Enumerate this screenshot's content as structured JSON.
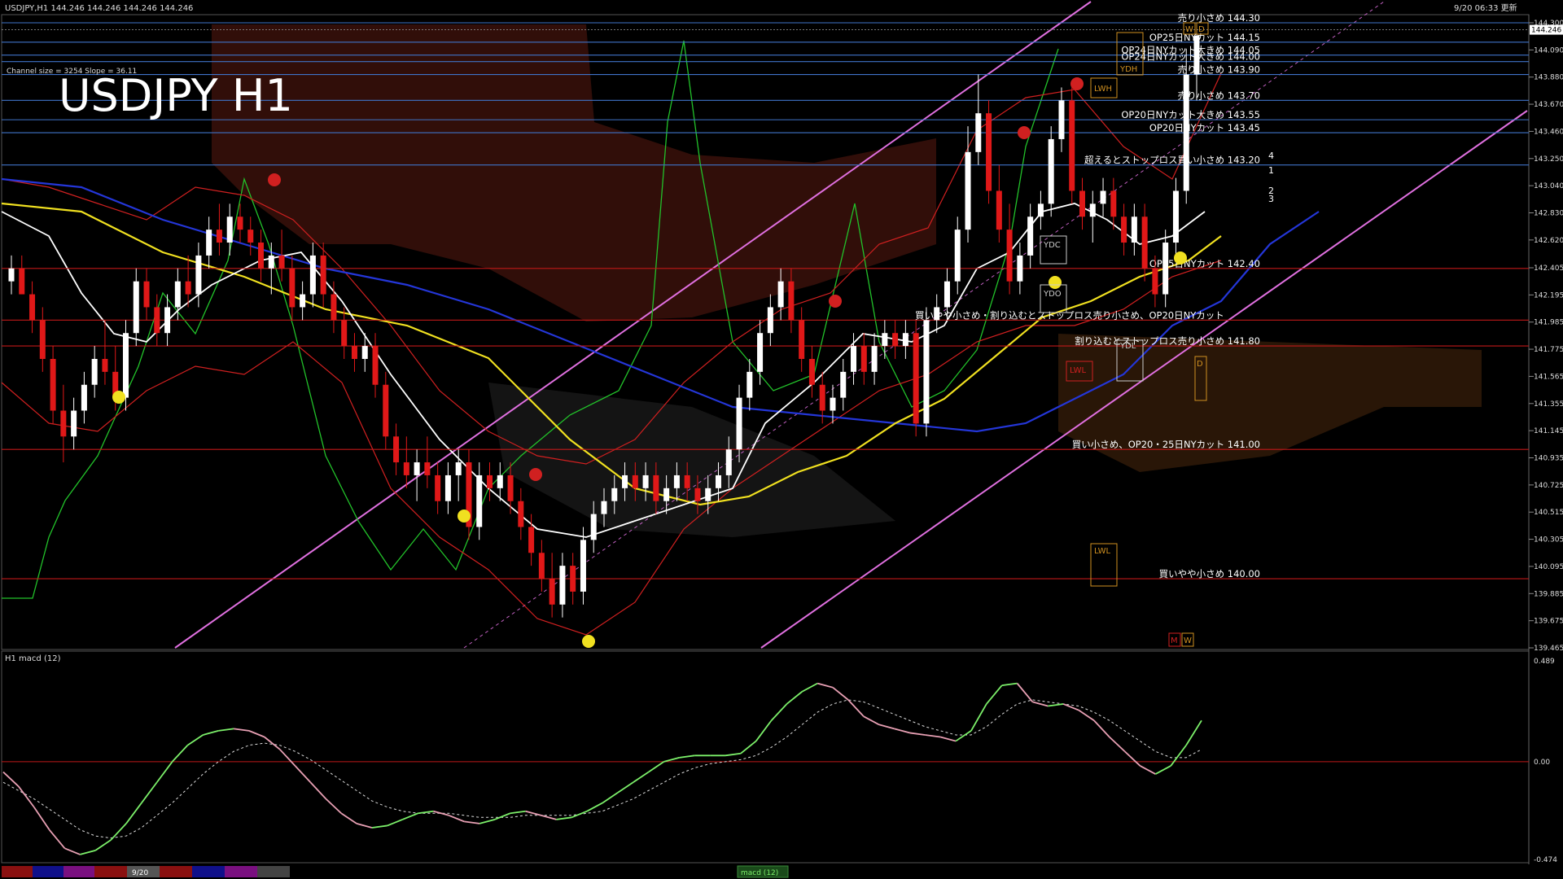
{
  "header": {
    "symbol_info": "USDJPY,H1  144.246 144.246 144.246 144.246",
    "datetime": "9/20 06:33 更新",
    "title": "USDJPY H1",
    "channel_info": "Channel size = 3254 Slope = 36.11"
  },
  "subwindow": {
    "label": "H1  macd (12)"
  },
  "bottom_tabs": {
    "active_date": "9/20",
    "macd_tab": "macd (12)"
  },
  "colors": {
    "background": "#000000",
    "price_line": "#4a7fcf",
    "macd_up": "#7cf06a",
    "macd_down": "#e8a0b4"
  },
  "chart_data": [
    {
      "type": "candlestick",
      "title": "USDJPY H1",
      "ylim": [
        139.465,
        144.3
      ],
      "current_price": 144.246,
      "y_ticks": [
        144.3,
        144.09,
        143.88,
        143.67,
        143.46,
        143.25,
        143.04,
        142.83,
        142.62,
        142.405,
        142.195,
        141.985,
        141.775,
        141.565,
        141.355,
        141.145,
        140.935,
        140.725,
        140.515,
        140.305,
        140.095,
        139.885,
        139.675,
        139.465
      ],
      "levels": [
        {
          "price": 144.3,
          "label": "売り小さめ 144.30"
        },
        {
          "price": 144.15,
          "label": "OP25日NYカット 144.15"
        },
        {
          "price": 144.05,
          "label": "OP24日NYカット大きめ 144.05"
        },
        {
          "price": 144.0,
          "label": "OP24日NYカット大きめ 144.00"
        },
        {
          "price": 143.9,
          "label": "売り小さめ 143.90"
        },
        {
          "price": 143.7,
          "label": "売り小さめ 143.70"
        },
        {
          "price": 143.55,
          "label": "OP20日NYカット大きめ 143.55"
        },
        {
          "price": 143.45,
          "label": "OP20日NYカット 143.45"
        },
        {
          "price": 143.2,
          "label": "超えるとストップロス買い小さめ 143.20"
        },
        {
          "price": 142.4,
          "label": "OP25日NYカット 142.40"
        },
        {
          "price": 142.0,
          "label": "買いやや小さめ・割り込むとストップロス売り小さめ、OP20日NYカット"
        },
        {
          "price": 141.8,
          "label": "割り込むとストップロス売り小さめ 141.80"
        },
        {
          "price": 141.0,
          "label": "買い小さめ、OP20・25日NYカット 141.00"
        },
        {
          "price": 140.0,
          "label": "買いやや小さめ 140.00"
        }
      ],
      "line_numbers": [
        "4",
        "1",
        "2",
        "3"
      ],
      "box_labels": [
        "YDC",
        "YDO",
        "YDH",
        "YDL",
        "LWH",
        "LWL",
        "W",
        "D",
        "M"
      ],
      "candles": [
        [
          142.3,
          142.5,
          142.2,
          142.4
        ],
        [
          142.4,
          142.5,
          142.3,
          142.2
        ],
        [
          142.2,
          142.3,
          141.9,
          142.0
        ],
        [
          142.0,
          142.1,
          141.6,
          141.7
        ],
        [
          141.7,
          141.8,
          141.2,
          141.3
        ],
        [
          141.3,
          141.5,
          140.9,
          141.1
        ],
        [
          141.1,
          141.4,
          141.0,
          141.3
        ],
        [
          141.3,
          141.6,
          141.2,
          141.5
        ],
        [
          141.5,
          141.8,
          141.4,
          141.7
        ],
        [
          141.7,
          142.0,
          141.5,
          141.6
        ],
        [
          141.6,
          141.8,
          141.3,
          141.4
        ],
        [
          141.4,
          142.0,
          141.3,
          141.9
        ],
        [
          141.9,
          142.4,
          141.8,
          142.3
        ],
        [
          142.3,
          142.4,
          142.0,
          142.1
        ],
        [
          142.1,
          142.2,
          141.8,
          141.9
        ],
        [
          141.9,
          142.2,
          141.8,
          142.1
        ],
        [
          142.1,
          142.4,
          142.0,
          142.3
        ],
        [
          142.3,
          142.5,
          142.1,
          142.2
        ],
        [
          142.2,
          142.6,
          142.1,
          142.5
        ],
        [
          142.5,
          142.8,
          142.4,
          142.7
        ],
        [
          142.7,
          142.9,
          142.5,
          142.6
        ],
        [
          142.6,
          142.9,
          142.5,
          142.8
        ],
        [
          142.8,
          142.9,
          142.6,
          142.7
        ],
        [
          142.7,
          142.8,
          142.5,
          142.6
        ],
        [
          142.6,
          142.7,
          142.3,
          142.4
        ],
        [
          142.4,
          142.6,
          142.2,
          142.5
        ],
        [
          142.5,
          142.7,
          142.3,
          142.4
        ],
        [
          142.4,
          142.5,
          142.0,
          142.1
        ],
        [
          142.1,
          142.3,
          142.0,
          142.2
        ],
        [
          142.2,
          142.6,
          142.1,
          142.5
        ],
        [
          142.5,
          142.6,
          142.1,
          142.2
        ],
        [
          142.2,
          142.3,
          141.9,
          142.0
        ],
        [
          142.0,
          142.1,
          141.7,
          141.8
        ],
        [
          141.8,
          141.9,
          141.6,
          141.7
        ],
        [
          141.7,
          141.9,
          141.6,
          141.8
        ],
        [
          141.8,
          141.9,
          141.4,
          141.5
        ],
        [
          141.5,
          141.6,
          141.0,
          141.1
        ],
        [
          141.1,
          141.2,
          140.8,
          140.9
        ],
        [
          140.9,
          141.1,
          140.7,
          140.8
        ],
        [
          140.8,
          141.0,
          140.6,
          140.9
        ],
        [
          140.9,
          141.1,
          140.7,
          140.8
        ],
        [
          140.8,
          140.9,
          140.5,
          140.6
        ],
        [
          140.6,
          140.9,
          140.5,
          140.8
        ],
        [
          140.8,
          141.0,
          140.6,
          140.9
        ],
        [
          140.9,
          141.0,
          140.3,
          140.4
        ],
        [
          140.4,
          140.9,
          140.3,
          140.8
        ],
        [
          140.8,
          140.9,
          140.6,
          140.7
        ],
        [
          140.7,
          140.9,
          140.6,
          140.8
        ],
        [
          140.8,
          140.9,
          140.5,
          140.6
        ],
        [
          140.6,
          140.7,
          140.3,
          140.4
        ],
        [
          140.4,
          140.5,
          140.1,
          140.2
        ],
        [
          140.2,
          140.3,
          139.9,
          140.0
        ],
        [
          140.0,
          140.2,
          139.7,
          139.8
        ],
        [
          139.8,
          140.2,
          139.7,
          140.1
        ],
        [
          140.1,
          140.2,
          139.8,
          139.9
        ],
        [
          139.9,
          140.4,
          139.8,
          140.3
        ],
        [
          140.3,
          140.6,
          140.2,
          140.5
        ],
        [
          140.5,
          140.7,
          140.4,
          140.6
        ],
        [
          140.6,
          140.8,
          140.5,
          140.7
        ],
        [
          140.7,
          140.9,
          140.6,
          140.8
        ],
        [
          140.8,
          140.9,
          140.6,
          140.7
        ],
        [
          140.7,
          140.9,
          140.6,
          140.8
        ],
        [
          140.8,
          140.9,
          140.5,
          140.6
        ],
        [
          140.6,
          140.8,
          140.5,
          140.7
        ],
        [
          140.7,
          140.9,
          140.6,
          140.8
        ],
        [
          140.8,
          140.9,
          140.6,
          140.7
        ],
        [
          140.7,
          140.8,
          140.5,
          140.6
        ],
        [
          140.6,
          140.8,
          140.5,
          140.7
        ],
        [
          140.7,
          140.9,
          140.6,
          140.8
        ],
        [
          140.8,
          141.1,
          140.7,
          141.0
        ],
        [
          141.0,
          141.5,
          140.9,
          141.4
        ],
        [
          141.4,
          141.7,
          141.3,
          141.6
        ],
        [
          141.6,
          142.0,
          141.5,
          141.9
        ],
        [
          141.9,
          142.2,
          141.8,
          142.1
        ],
        [
          142.1,
          142.4,
          142.0,
          142.3
        ],
        [
          142.3,
          142.4,
          141.9,
          142.0
        ],
        [
          142.0,
          142.1,
          141.6,
          141.7
        ],
        [
          141.7,
          141.8,
          141.4,
          141.5
        ],
        [
          141.5,
          141.6,
          141.2,
          141.3
        ],
        [
          141.3,
          141.5,
          141.2,
          141.4
        ],
        [
          141.4,
          141.7,
          141.3,
          141.6
        ],
        [
          141.6,
          141.9,
          141.5,
          141.8
        ],
        [
          141.8,
          141.9,
          141.5,
          141.6
        ],
        [
          141.6,
          141.9,
          141.5,
          141.8
        ],
        [
          141.8,
          142.0,
          141.7,
          141.9
        ],
        [
          141.9,
          142.0,
          141.7,
          141.8
        ],
        [
          141.8,
          142.0,
          141.7,
          141.9
        ],
        [
          141.9,
          142.0,
          141.1,
          141.2
        ],
        [
          141.2,
          142.1,
          141.1,
          142.0
        ],
        [
          142.0,
          142.2,
          141.9,
          142.1
        ],
        [
          142.1,
          142.4,
          142.0,
          142.3
        ],
        [
          142.3,
          142.8,
          142.2,
          142.7
        ],
        [
          142.7,
          143.5,
          142.6,
          143.3
        ],
        [
          143.3,
          143.9,
          143.2,
          143.6
        ],
        [
          143.6,
          143.7,
          142.9,
          143.0
        ],
        [
          143.0,
          143.2,
          142.6,
          142.7
        ],
        [
          142.7,
          142.9,
          142.2,
          142.3
        ],
        [
          142.3,
          142.6,
          142.2,
          142.5
        ],
        [
          142.5,
          142.9,
          142.4,
          142.8
        ],
        [
          142.8,
          143.0,
          142.7,
          142.9
        ],
        [
          142.9,
          143.5,
          142.8,
          143.4
        ],
        [
          143.4,
          143.8,
          143.3,
          143.7
        ],
        [
          143.7,
          143.8,
          142.9,
          143.0
        ],
        [
          143.0,
          143.1,
          142.7,
          142.8
        ],
        [
          142.8,
          143.0,
          142.6,
          142.9
        ],
        [
          142.9,
          143.1,
          142.8,
          143.0
        ],
        [
          143.0,
          143.1,
          142.7,
          142.8
        ],
        [
          142.8,
          142.9,
          142.5,
          142.6
        ],
        [
          142.6,
          142.9,
          142.5,
          142.8
        ],
        [
          142.8,
          142.9,
          142.3,
          142.4
        ],
        [
          142.4,
          142.5,
          142.1,
          142.2
        ],
        [
          142.2,
          142.7,
          142.1,
          142.6
        ],
        [
          142.6,
          143.1,
          142.5,
          143.0
        ],
        [
          143.0,
          144.1,
          142.9,
          143.9
        ],
        [
          143.9,
          144.3,
          143.7,
          144.2
        ]
      ]
    },
    {
      "type": "line",
      "title": "macd (12)",
      "ylim": [
        -0.474,
        0.489
      ],
      "y_ticks": [
        0.489,
        0.0,
        -0.474
      ],
      "series": [
        {
          "values": [
            -0.05,
            -0.12,
            -0.22,
            -0.33,
            -0.42,
            -0.45,
            -0.43,
            -0.38,
            -0.3,
            -0.2,
            -0.1,
            0.0,
            0.08,
            0.13,
            0.15,
            0.16,
            0.15,
            0.12,
            0.06,
            -0.02,
            -0.1,
            -0.18,
            -0.25,
            -0.3,
            -0.32,
            -0.31,
            -0.28,
            -0.25,
            -0.24,
            -0.26,
            -0.29,
            -0.3,
            -0.28,
            -0.25,
            -0.24,
            -0.26,
            -0.28,
            -0.27,
            -0.24,
            -0.2,
            -0.15,
            -0.1,
            -0.05,
            0.0,
            0.02,
            0.03,
            0.03,
            0.03,
            0.04,
            0.1,
            0.2,
            0.28,
            0.34,
            0.38,
            0.36,
            0.3,
            0.22,
            0.18,
            0.16,
            0.14,
            0.13,
            0.12,
            0.1,
            0.15,
            0.28,
            0.37,
            0.38,
            0.29,
            0.27,
            0.28,
            0.25,
            0.2,
            0.12,
            0.05,
            -0.02,
            -0.06,
            -0.02,
            0.08,
            0.2
          ]
        },
        {
          "values": [
            -0.1,
            -0.14,
            -0.18,
            -0.23,
            -0.28,
            -0.33,
            -0.36,
            -0.37,
            -0.36,
            -0.32,
            -0.26,
            -0.2,
            -0.13,
            -0.06,
            0.0,
            0.05,
            0.08,
            0.09,
            0.08,
            0.05,
            0.01,
            -0.04,
            -0.09,
            -0.14,
            -0.19,
            -0.22,
            -0.24,
            -0.25,
            -0.25,
            -0.25,
            -0.26,
            -0.27,
            -0.27,
            -0.27,
            -0.26,
            -0.26,
            -0.26,
            -0.26,
            -0.25,
            -0.24,
            -0.21,
            -0.18,
            -0.14,
            -0.1,
            -0.06,
            -0.03,
            -0.01,
            0.0,
            0.01,
            0.03,
            0.07,
            0.12,
            0.18,
            0.24,
            0.28,
            0.3,
            0.29,
            0.26,
            0.23,
            0.2,
            0.17,
            0.15,
            0.13,
            0.13,
            0.17,
            0.23,
            0.28,
            0.3,
            0.29,
            0.28,
            0.27,
            0.24,
            0.2,
            0.15,
            0.1,
            0.05,
            0.02,
            0.02,
            0.06
          ]
        }
      ]
    }
  ]
}
